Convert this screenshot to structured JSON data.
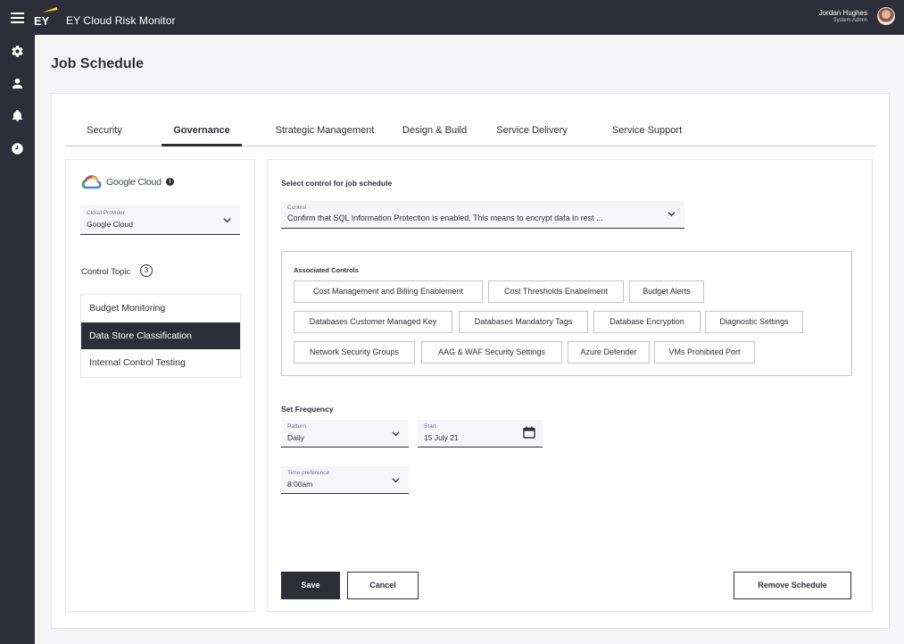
{
  "app": {
    "brand": "EY",
    "title": "EY Cloud Risk Monitor"
  },
  "user": {
    "name": "Jordan Hughes",
    "role": "System Admin"
  },
  "sidenav": [
    {
      "icon": "gear-icon"
    },
    {
      "icon": "person-icon"
    },
    {
      "icon": "bell-icon"
    },
    {
      "icon": "clock-icon"
    }
  ],
  "page": {
    "title": "Job Schedule"
  },
  "tabs": [
    {
      "label": "Security"
    },
    {
      "label": "Governance",
      "active": true
    },
    {
      "label": "Strategic Management"
    },
    {
      "label": "Design & Build"
    },
    {
      "label": "Service Delivery"
    },
    {
      "label": "Service Support"
    }
  ],
  "left": {
    "provider_logo_text": "Google Cloud",
    "provider_select": {
      "label": "Cloud Provider",
      "value": "Google Cloud"
    },
    "topic_label": "Control Topic",
    "topic_count": "3",
    "topics": [
      {
        "label": "Budget Monitoring"
      },
      {
        "label": "Data Store Classification",
        "active": true
      },
      {
        "label": "Internal Control Testing"
      }
    ]
  },
  "right": {
    "select_title": "Select control for job schedule",
    "control_select": {
      "label": "Control",
      "value": "Confirm that SQL Information Protection is enabled. This means to encrypt data in rest ..."
    },
    "associated_title": "Associated Controls",
    "associated_controls": [
      "Cost Management and Billing Enablement",
      "Cost Thresholds Enabelment",
      "Budget Alerts",
      "Databases Customer Managed Key",
      "Databases Mandatory Tags",
      "Database Encryption",
      "Diagnostic Settings",
      "Network Security Groups",
      "AAG & WAF Security Settings",
      "Azure Defender",
      "VMs Prohibited Port"
    ],
    "frequency_title": "Set Frequency",
    "pattern": {
      "label": "Pattern",
      "value": "Daily"
    },
    "start": {
      "label": "Start",
      "value": "15 July 21"
    },
    "time_pref": {
      "label": "Time preference",
      "value": "8:00am"
    },
    "buttons": {
      "save": "Save",
      "cancel": "Cancel",
      "remove": "Remove Schedule"
    }
  },
  "colors": {
    "dark": "#2e2e38",
    "accent_yellow": "#ffe600",
    "border": "#c4c4cd"
  }
}
